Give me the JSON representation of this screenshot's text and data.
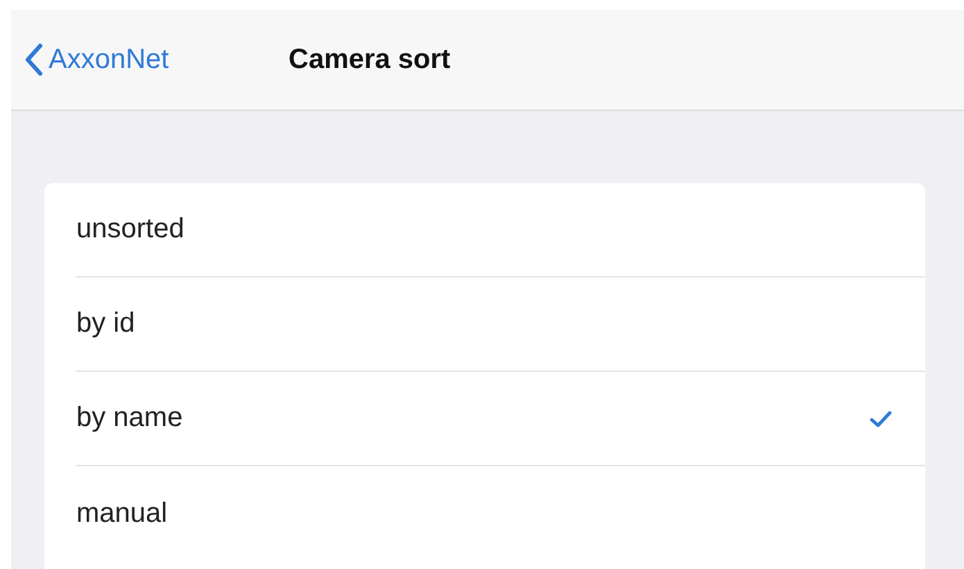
{
  "nav_bar": {
    "back_label": "AxxonNet",
    "title": "Camera sort"
  },
  "options": [
    {
      "label": "unsorted",
      "selected": false
    },
    {
      "label": "by id",
      "selected": false
    },
    {
      "label": "by name",
      "selected": true
    },
    {
      "label": "manual",
      "selected": false
    }
  ]
}
